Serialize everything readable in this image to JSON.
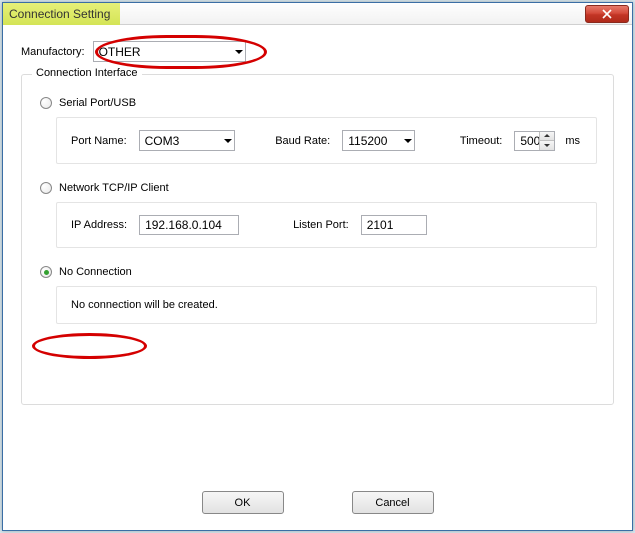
{
  "window": {
    "title": "Connection Setting"
  },
  "manufactory": {
    "label": "Manufactory:",
    "value": "OTHER"
  },
  "group": {
    "legend": "Connection Interface"
  },
  "serial": {
    "radio_label": "Serial Port/USB",
    "port_label": "Port Name:",
    "port_value": "COM3",
    "baud_label": "Baud Rate:",
    "baud_value": "115200",
    "timeout_label": "Timeout:",
    "timeout_value": "500",
    "timeout_unit": "ms"
  },
  "tcp": {
    "radio_label": "Network TCP/IP Client",
    "ip_label": "IP Address:",
    "ip_value": "192.168.0.104",
    "port_label": "Listen Port:",
    "port_value": "2101"
  },
  "noconn": {
    "radio_label": "No Connection",
    "desc": "No connection will be created."
  },
  "buttons": {
    "ok": "OK",
    "cancel": "Cancel"
  },
  "selected_interface": "noconn"
}
